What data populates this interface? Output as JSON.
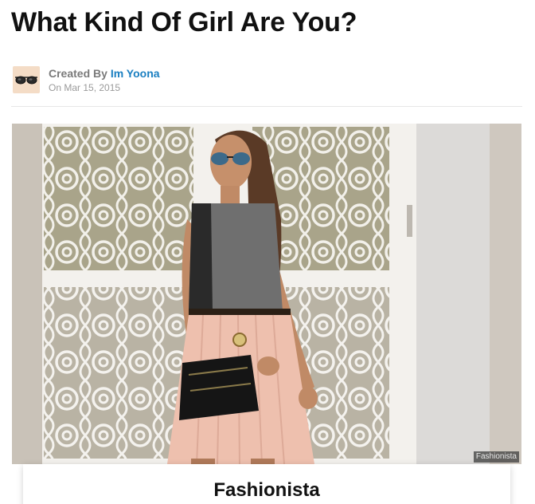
{
  "quiz": {
    "title": "What Kind Of Girl Are You?"
  },
  "author": {
    "created_by_label": "Created By",
    "name": "Im Yoona",
    "date": "On Mar 15, 2015",
    "avatar_icon": "sunglasses-icon"
  },
  "result": {
    "image_credit": "Fashionista",
    "title": "Fashionista"
  },
  "colors": {
    "link": "#1a7fc1",
    "title": "#111111",
    "meta": "#7a7a7a",
    "avatar_bg": "#f4dcc6"
  }
}
